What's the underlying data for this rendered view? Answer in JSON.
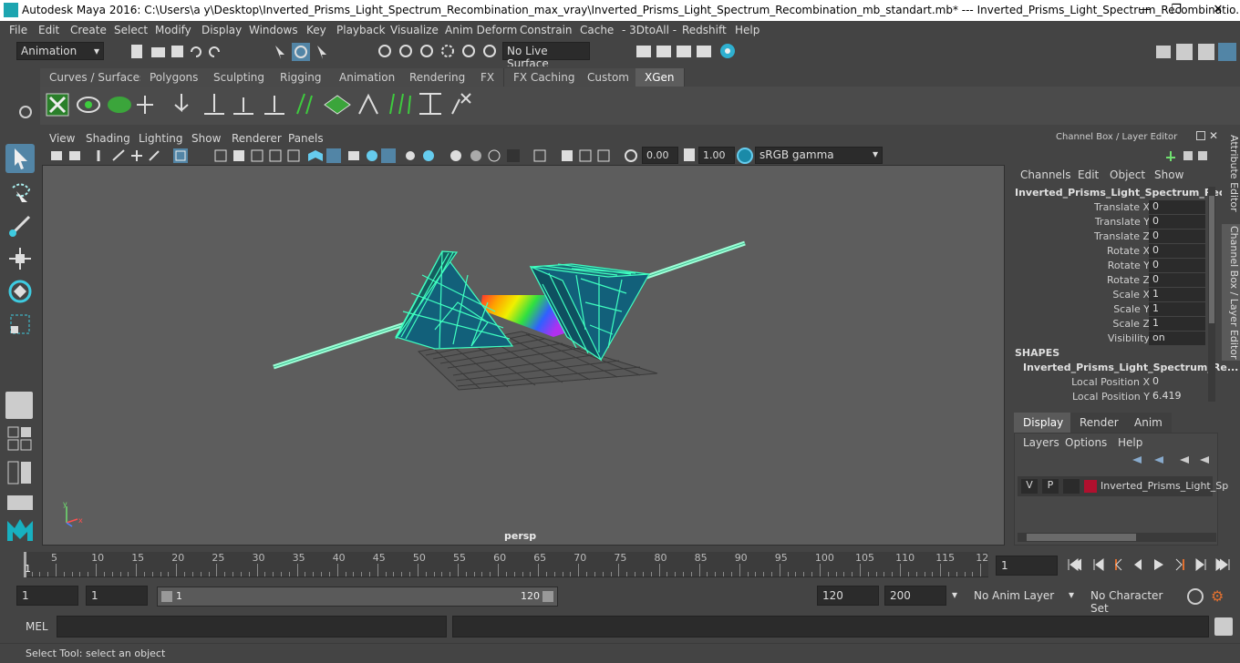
{
  "titlebar": {
    "title": "Autodesk Maya 2016: C:\\Users\\a y\\Desktop\\Inverted_Prisms_Light_Spectrum_Recombination_max_vray\\Inverted_Prisms_Light_Spectrum_Recombination_mb_standart.mb*  ---  Inverted_Prisms_Light_Spectrum_Recombinatio...",
    "minimize": "—",
    "maximize": "❐",
    "close": "✕"
  },
  "menubar": [
    "File",
    "Edit",
    "Create",
    "Select",
    "Modify",
    "Display",
    "Windows",
    "Key",
    "Playback",
    "Visualize",
    "Anim Deform",
    "Constrain",
    "Cache",
    "- 3DtoAll -",
    "Redshift",
    "Help"
  ],
  "statusline": {
    "mode": "Animation",
    "live_surface": "No Live Surface"
  },
  "shelf_tabs": [
    "Curves / Surfaces",
    "Polygons",
    "Sculpting",
    "Rigging",
    "Animation",
    "Rendering",
    "FX",
    "FX Caching",
    "Custom",
    "XGen"
  ],
  "active_shelf_tab": "XGen",
  "panel_menu": [
    "View",
    "Shading",
    "Lighting",
    "Show",
    "Renderer",
    "Panels"
  ],
  "view_toolbar": {
    "exposure": "0.00",
    "gamma": "1.00",
    "color_space": "sRGB gamma"
  },
  "viewport": {
    "camera": "persp"
  },
  "channel_box": {
    "header": "Channel Box / Layer Editor",
    "menus": [
      "Channels",
      "Edit",
      "Object",
      "Show"
    ],
    "object_name": "Inverted_Prisms_Light_Spectrum_Reco...",
    "channels": [
      {
        "label": "Translate X",
        "value": "0"
      },
      {
        "label": "Translate Y",
        "value": "0"
      },
      {
        "label": "Translate Z",
        "value": "0"
      },
      {
        "label": "Rotate X",
        "value": "0"
      },
      {
        "label": "Rotate Y",
        "value": "0"
      },
      {
        "label": "Rotate Z",
        "value": "0"
      },
      {
        "label": "Scale X",
        "value": "1"
      },
      {
        "label": "Scale Y",
        "value": "1"
      },
      {
        "label": "Scale Z",
        "value": "1"
      },
      {
        "label": "Visibility",
        "value": "on"
      }
    ],
    "shapes_label": "SHAPES",
    "shape_name": "Inverted_Prisms_Light_Spectrum_Re...",
    "shape_channels": [
      {
        "label": "Local Position X",
        "value": "0"
      },
      {
        "label": "Local Position Y",
        "value": "6.419"
      }
    ],
    "side_tabs": [
      "Attribute Editor",
      "Channel Box / Layer Editor"
    ]
  },
  "layer_editor": {
    "tabs": [
      "Display",
      "Render",
      "Anim"
    ],
    "active_tab": "Display",
    "menus": [
      "Layers",
      "Options",
      "Help"
    ],
    "layer": {
      "v": "V",
      "p": "P",
      "name": "Inverted_Prisms_Light_Sp",
      "color": "#b0102e"
    }
  },
  "timeline": {
    "ticks": [
      "5",
      "10",
      "15",
      "20",
      "25",
      "30",
      "35",
      "40",
      "45",
      "50",
      "55",
      "60",
      "65",
      "70",
      "75",
      "80",
      "85",
      "90",
      "95",
      "100",
      "105",
      "110",
      "115",
      "12"
    ],
    "current_frame": "1",
    "current_frame_field": "1"
  },
  "range": {
    "start": "1",
    "playback_start": "1",
    "slider_start": "1",
    "slider_end": "120",
    "playback_end": "120",
    "end": "200",
    "anim_layer": "No Anim Layer",
    "character_set": "No Character Set"
  },
  "mel": {
    "label": "MEL"
  },
  "helpline": "Select Tool: select an object",
  "colors": {
    "bg": "#444444",
    "viewport": "#5d5d5d",
    "wire": "#3fffc0",
    "prism_fill": "#12607a",
    "accent": "#5285a6"
  }
}
